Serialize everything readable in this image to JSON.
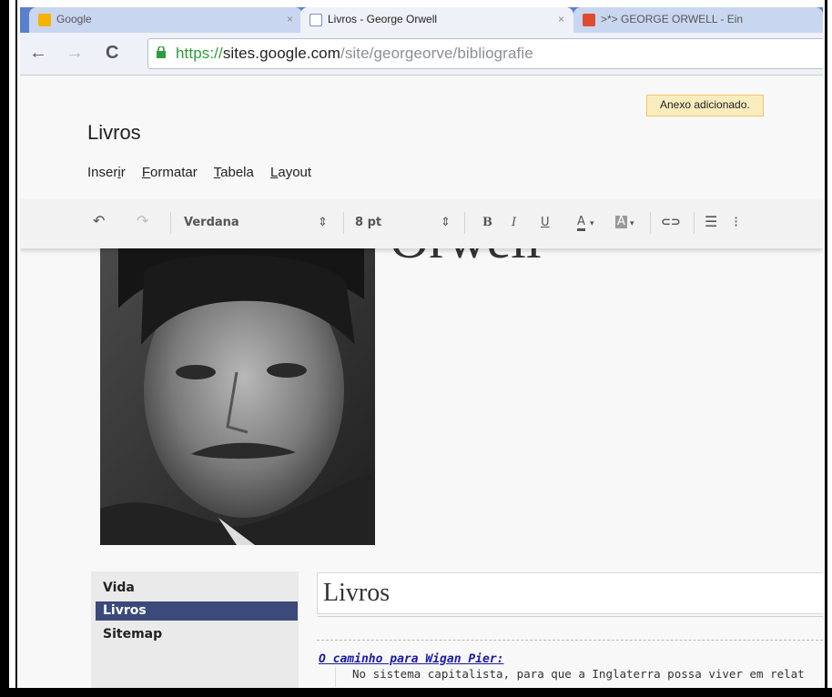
{
  "browser": {
    "tabs": [
      {
        "title": "Google",
        "active": false,
        "favicon_color": "#f4b400"
      },
      {
        "title": "Livros - George Orwell",
        "active": true,
        "favicon_color": "#7c8fd0"
      },
      {
        "title": ">*> GEORGE ORWELL - Ein",
        "active": false,
        "favicon_color": "#e04a2f"
      }
    ],
    "close_glyph": "×",
    "url_scheme": "https://",
    "url_host": "sites.google.com",
    "url_path": "/site/georgeorve/bibliografie"
  },
  "notice": "Anexo adicionado.",
  "editor": {
    "doc_title": "Livros",
    "menus": [
      "Inserir",
      "Formatar",
      "Tabela",
      "Layout"
    ],
    "font": "Verdana",
    "size": "8 pt",
    "bold": "B",
    "italic": "I",
    "underline": "U",
    "text_color": "A",
    "highlight": "A"
  },
  "page": {
    "big_title": "Orwell",
    "sidebar": {
      "items": [
        {
          "label": "Vida",
          "active": false
        },
        {
          "label": "Livros",
          "active": true
        },
        {
          "label": "Sitemap",
          "active": false
        }
      ]
    },
    "heading": "Livros",
    "book_title": "O caminho para Wigan Pier:",
    "book_text": "No sistema capitalista, para que a Inglaterra possa viver em relat"
  }
}
